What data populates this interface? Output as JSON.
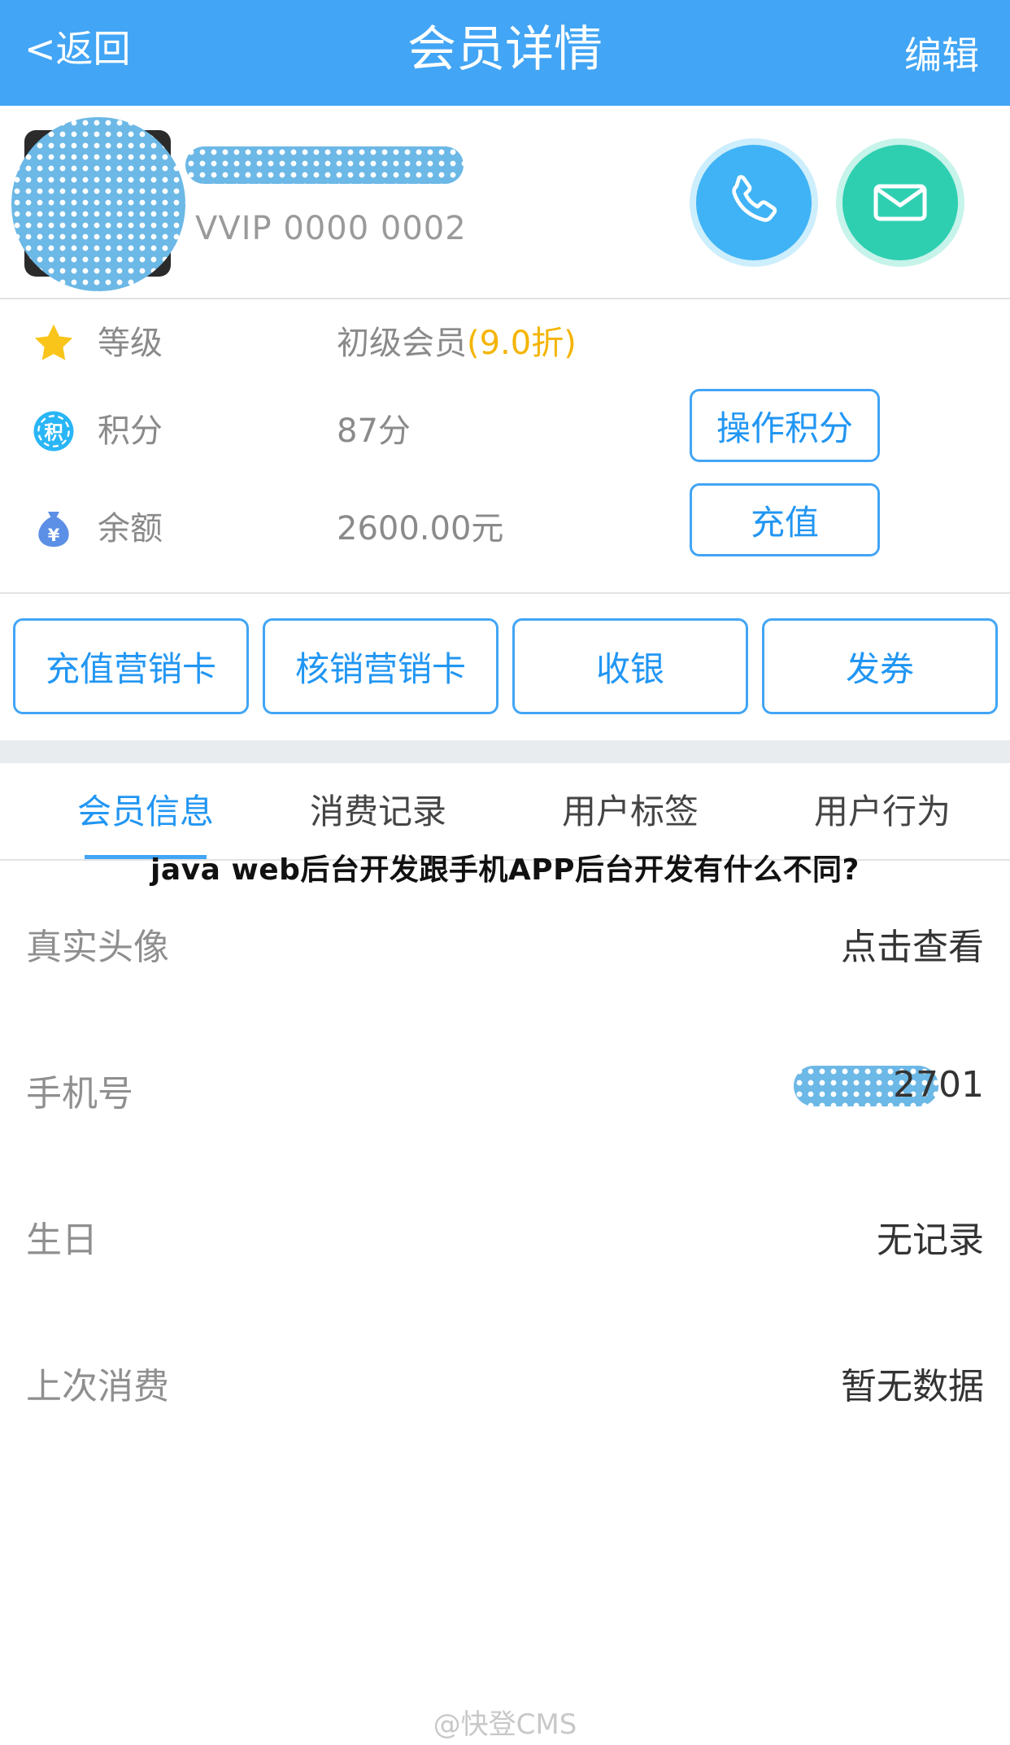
{
  "nav": {
    "back_label": "<返回",
    "title": "会员详情",
    "edit_label": "编辑"
  },
  "profile": {
    "member_no": "VVIP 0000 0002"
  },
  "info": {
    "level": {
      "label": "等级",
      "value": "初级会员",
      "discount": "(9.0折)"
    },
    "points": {
      "label": "积分",
      "value": "87分",
      "button": "操作积分"
    },
    "balance": {
      "label": "余额",
      "value": "2600.00元",
      "button": "充值"
    }
  },
  "actions": [
    "充值营销卡",
    "核销营销卡",
    "收银",
    "发券"
  ],
  "tabs": [
    "会员信息",
    "消费记录",
    "用户标签",
    "用户行为"
  ],
  "overlay_title": "java web后台开发跟手机APP后台开发有什么不同?",
  "details": [
    {
      "label": "真实头像",
      "value": "点击查看"
    },
    {
      "label": "手机号",
      "value": "2701"
    },
    {
      "label": "生日",
      "value": "无记录"
    },
    {
      "label": "上次消费",
      "value": "暂无数据"
    }
  ],
  "watermark": "@快登CMS",
  "colors": {
    "primary": "#42a5f5",
    "phone_button": "#3fb3f5",
    "mail_button": "#2ecfb1",
    "discount": "#f4b400"
  }
}
